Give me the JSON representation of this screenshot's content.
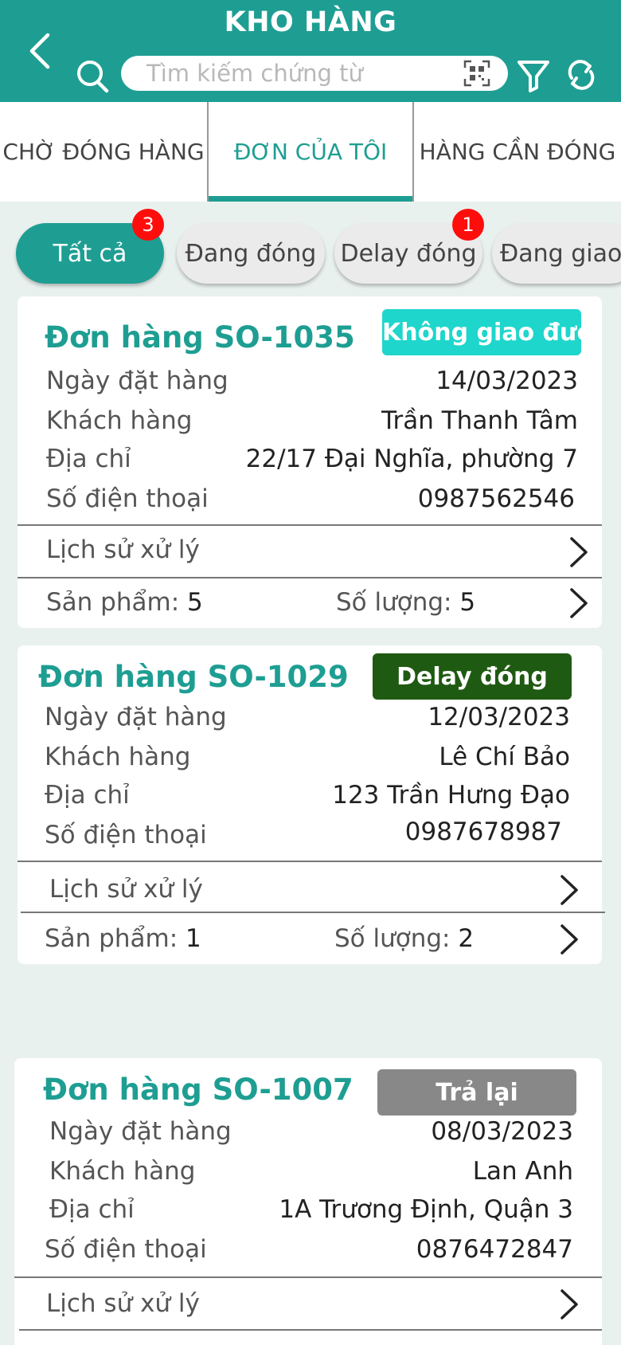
{
  "header": {
    "title": "KHO HÀNG",
    "search_placeholder": "Tìm kiếm chứng từ",
    "icons": [
      "back-arrow-icon",
      "search-icon",
      "qr-scan-icon",
      "filter-icon",
      "refresh-icon"
    ]
  },
  "tabs": [
    {
      "label": "CHỜ ĐÓNG HÀNG",
      "active": false
    },
    {
      "label": "ĐƠN CỦA TÔI",
      "active": true
    },
    {
      "label": "HÀNG CẦN ĐÓNG",
      "active": false
    }
  ],
  "filters": [
    {
      "label": "Tất cả",
      "active": true,
      "badge": "3"
    },
    {
      "label": "Đang đóng",
      "active": false
    },
    {
      "label": "Delay đóng",
      "active": false,
      "badge": "1"
    },
    {
      "label": "Đang giao",
      "active": false
    }
  ],
  "labels": {
    "order_date": "Ngày đặt hàng",
    "customer": "Khách hàng",
    "address": "Địa chỉ",
    "phone": "Số điện thoại",
    "history": "Lịch sử xử lý",
    "products": "Sản phẩm:",
    "quantity": "Số lượng:"
  },
  "orders": [
    {
      "title": "Đơn hàng SO-1035",
      "status": "Không giao được",
      "status_color": "#1ed6cc",
      "order_date": "14/03/2023",
      "customer": "Trần Thanh Tâm",
      "address": "22/17 Đại Nghĩa, phường 7",
      "phone": "0987562546",
      "products": "5",
      "quantity": "5"
    },
    {
      "title": "Đơn hàng SO-1029",
      "status": "Delay đóng",
      "status_color": "#1f5a12",
      "order_date": "12/03/2023",
      "customer": "Lê Chí Bảo",
      "address": "123 Trần Hưng Đạo",
      "phone": "0987678987",
      "products": "1",
      "quantity": "2"
    },
    {
      "title": "Đơn hàng SO-1007",
      "status": "Trả lại",
      "status_color": "#888888",
      "order_date": "08/03/2023",
      "customer": "Lan Anh",
      "address": "1A Trương Định, Quận 3",
      "phone": "0876472847"
    }
  ],
  "colors": {
    "primary": "#1e9e92",
    "badge": "#ff0d0d",
    "background": "#e9f1ef"
  }
}
